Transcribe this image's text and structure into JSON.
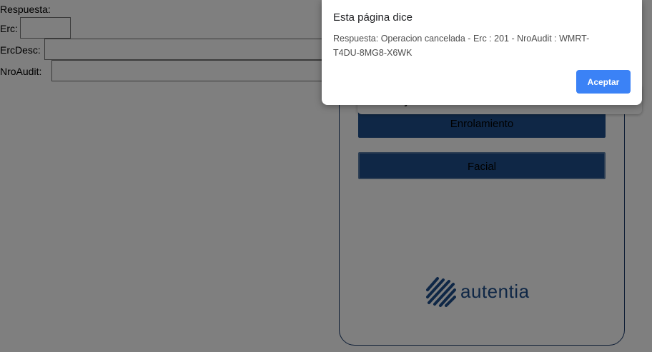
{
  "form": {
    "respuesta_label": "Respuesta:",
    "erc_label": "Erc:",
    "ercdesc_label": "ErcDesc:",
    "nroaudit_label": "NroAudit:",
    "erc_value": "",
    "ercdesc_value": "",
    "nroaudit_value": ""
  },
  "panel": {
    "toast_text": "Ejecutando transacción autentia",
    "enrolamiento_button": "Enrolamiento",
    "facial_button": "Facial",
    "logo_text": "autentia"
  },
  "dialog": {
    "title": "Esta página dice",
    "message": "Respuesta: Operacion cancelada - Erc : 201 - NroAudit : WMRT-T4DU-8MG8-X6WK",
    "ok_button": "Aceptar"
  },
  "colors": {
    "brand": "#1e4f8c",
    "accept_button": "#3b82f6"
  }
}
